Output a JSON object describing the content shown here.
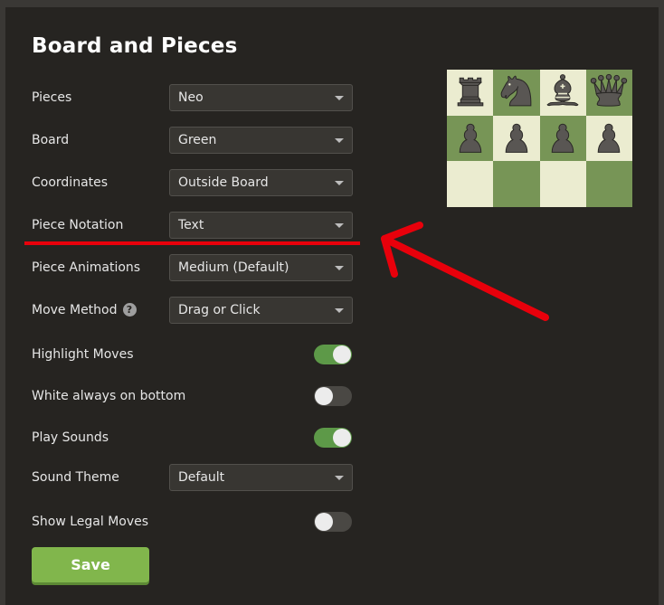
{
  "panel": {
    "title": "Board and Pieces"
  },
  "settings": {
    "pieces": {
      "label": "Pieces",
      "value": "Neo"
    },
    "board": {
      "label": "Board",
      "value": "Green"
    },
    "coordinates": {
      "label": "Coordinates",
      "value": "Outside Board"
    },
    "piece_notation": {
      "label": "Piece Notation",
      "value": "Text"
    },
    "piece_animations": {
      "label": "Piece Animations",
      "value": "Medium (Default)"
    },
    "move_method": {
      "label": "Move Method",
      "value": "Drag or Click",
      "help": "?"
    },
    "highlight_moves": {
      "label": "Highlight Moves",
      "on": true
    },
    "white_on_bottom": {
      "label": "White always on bottom",
      "on": false
    },
    "play_sounds": {
      "label": "Play Sounds",
      "on": true
    },
    "sound_theme": {
      "label": "Sound Theme",
      "value": "Default"
    },
    "show_legal_moves": {
      "label": "Show Legal Moves",
      "on": false
    }
  },
  "save_label": "Save",
  "preview": {
    "rows": [
      [
        "rook",
        "knight",
        "bishop",
        "queen"
      ],
      [
        "pawn",
        "pawn",
        "pawn",
        "pawn"
      ],
      [
        "",
        "",
        "",
        ""
      ]
    ],
    "light_color": "#ebecd0",
    "dark_color": "#779556",
    "piece_color": "#595653"
  },
  "colors": {
    "accent_green": "#81b64c",
    "toggle_on": "#5d9948",
    "annotation_red": "#e8000b"
  }
}
